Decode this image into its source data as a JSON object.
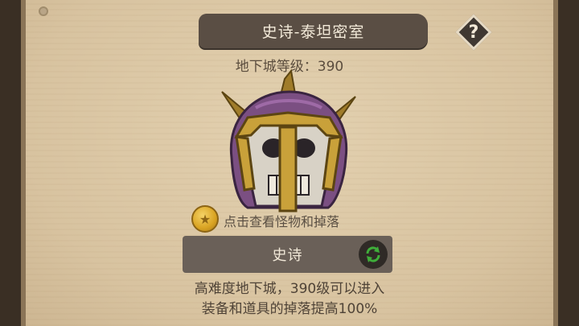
{
  "dungeon": {
    "title": "史诗-泰坦密室",
    "level_text": "地下城等级：390"
  },
  "help": {
    "label": "?"
  },
  "loot": {
    "link_text": "点击查看怪物和掉落"
  },
  "mode": {
    "label": "史诗"
  },
  "description": {
    "line1": "高难度地下城，390级可以进入",
    "line2": "装备和道具的掉落提高100%"
  },
  "icons": {
    "helmet": "skull-helmet-icon",
    "coin": "coin-icon",
    "switch": "refresh-arrows-icon",
    "help": "question-diamond-icon"
  },
  "colors": {
    "panel": "#dcc8a6",
    "banner": "#5a4e44",
    "mode_bar": "#6a6058",
    "switch_green": "#3fae3a"
  }
}
